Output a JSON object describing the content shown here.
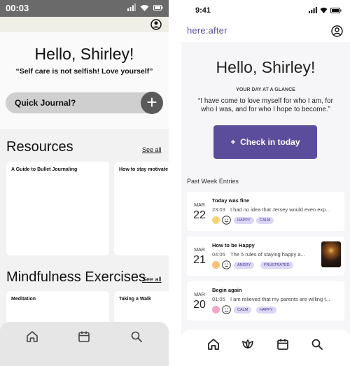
{
  "left": {
    "status": {
      "time": "00:03"
    },
    "greeting": "Hello, Shirley!",
    "quote": "“Self care is not selfish! Love yourself”",
    "quick_journal": {
      "label": "Quick Journal?",
      "plus": "+"
    },
    "resources": {
      "title": "Resources",
      "see_all": "See all",
      "cards": [
        "A Guide to Bullet Journaling",
        "How to stay motivate"
      ]
    },
    "mindfulness": {
      "title": "Mindfulness Exercises",
      "see_all": "See all",
      "cards": [
        "Meditation",
        "Taking a Walk"
      ]
    },
    "tabs": [
      "home-icon",
      "calendar-icon",
      "search-icon"
    ]
  },
  "right": {
    "status": {
      "time": "9:41"
    },
    "logo": "here:after",
    "greeting": "Hello, Shirley!",
    "glance_label": "YOUR DAY AT A GLANCE",
    "quote": "“I have come to love myself for who I am, for who I was, and for who I hope to become.”",
    "checkin": {
      "icon": "+",
      "label": "Check in today"
    },
    "past_week_label": "Past Week Entries",
    "entries": [
      {
        "month": "MAR",
        "day": "22",
        "title": "Today was fine",
        "time": "23:03",
        "excerpt": "I had no idea that Jersey would even exp...",
        "dot_color": "#f7d37a",
        "tags": [
          "HAPPY",
          "CALM"
        ],
        "has_image": false
      },
      {
        "month": "MAR",
        "day": "21",
        "title": "How to be Happy",
        "time": "04:05",
        "excerpt": "The 5 rules of staying happy a...",
        "dot_color": "#f7c07a",
        "tags": [
          "ANGRY",
          "FRUSTRATED"
        ],
        "has_image": true
      },
      {
        "month": "MAR",
        "day": "20",
        "title": "Begin again",
        "time": "01:05",
        "excerpt": "I am relieved that my parents are willing t...",
        "dot_color": "#f4a6c8",
        "tags": [
          "CALM",
          "HAPPY"
        ],
        "has_image": false
      }
    ],
    "tabs": [
      "home-icon",
      "lotus-icon",
      "calendar-icon",
      "search-icon"
    ]
  },
  "colors": {
    "brand_purple": "#5b4d9b",
    "tag_bg": "#dcd6f5"
  }
}
